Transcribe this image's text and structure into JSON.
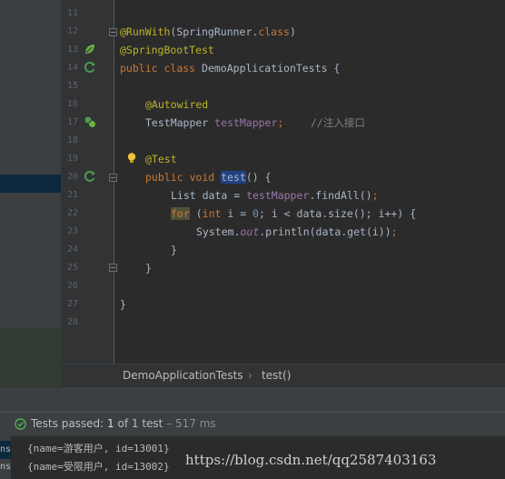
{
  "editor": {
    "line_numbers": [
      "11",
      "12",
      "13",
      "14",
      "15",
      "16",
      "17",
      "18",
      "19",
      "20",
      "21",
      "22",
      "23",
      "24",
      "25",
      "26",
      "27",
      "28"
    ],
    "lines": {
      "l12": {
        "annotation": "@RunWith",
        "p1": "(SpringRunner.",
        "class_kw": "class",
        "p2": ")"
      },
      "l13": {
        "annotation": "@SpringBootTest"
      },
      "l14": {
        "kw1": "public",
        "kw2": "class",
        "rest": " DemoApplicationTests {"
      },
      "l16": {
        "annotation": "@Autowired"
      },
      "l17": {
        "type": "TestMapper ",
        "field": "testMapper",
        "semi": ";",
        "comment": "//注入接口"
      },
      "l19": {
        "annotation": "@Test"
      },
      "l20": {
        "kw1": "public",
        "kw2": "void",
        "method": "test",
        "rest": "() {"
      },
      "l21": {
        "pre": "List data = ",
        "field": "testMapper",
        "rest": ".findAll()",
        "semi": ";"
      },
      "l22": {
        "kw_for": "for",
        "p1": " (",
        "kw_int": "int",
        "p2": " i = ",
        "num": "0",
        "p3": "; i < data.size(); i++) {"
      },
      "l23": {
        "pre": "System.",
        "out": "out",
        "rest": ".println(data.get(i))",
        "semi": ";"
      },
      "l24": {
        "text": "}"
      },
      "l25": {
        "text": "}"
      },
      "l27": {
        "text": "}"
      }
    }
  },
  "breadcrumb": {
    "class_name": "DemoApplicationTests",
    "separator": "›",
    "method": "test()"
  },
  "run_status": {
    "prefix": "Tests passed: ",
    "passed": "1",
    "of_text": " of 1 test",
    "duration": " – 517 ms"
  },
  "console": {
    "side_tab_1": "ns",
    "side_tab_2": "ns",
    "lines": [
      "{name=游客用户, id=13001}",
      "{name=受限用户, id=13002}"
    ]
  },
  "watermark": "https://blog.csdn.net/qq2587403163",
  "colors": {
    "keyword": "#cc7832",
    "annotation": "#bbb529",
    "field": "#9876aa",
    "number": "#6897bb",
    "comment": "#808080",
    "pass_green": "#4caf50",
    "run_gutter_green": "#4c9a52"
  },
  "icons": [
    "spring-bean-icon",
    "run-test-icon",
    "autowired-bean-icon",
    "intention-bulb-icon",
    "pass-check-icon"
  ]
}
